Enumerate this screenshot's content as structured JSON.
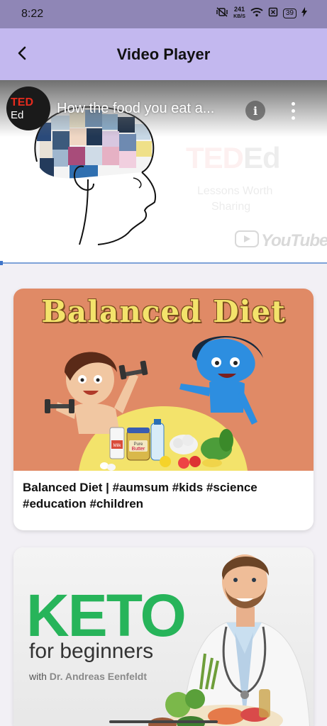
{
  "status_bar": {
    "time": "8:22",
    "net_speed_value": "241",
    "net_speed_unit": "KB/S",
    "battery": "39"
  },
  "app_bar": {
    "title": "Video Player",
    "back_icon": "back-arrow-icon"
  },
  "player": {
    "channel_avatar_top": "TED",
    "channel_avatar_bottom": "Ed",
    "video_title": "How the food you eat a...",
    "info_label": "i",
    "watermark_brand_a": "TED",
    "watermark_brand_b": "Ed",
    "watermark_line1": "Lessons Worth",
    "watermark_line2": "Sharing",
    "youtube_label": "YouTube"
  },
  "videos": [
    {
      "thumb_title": "Balanced Diet",
      "milk_label": "Milk",
      "butter_label_1": "Pure",
      "butter_label_2": "Butter",
      "caption": "Balanced Diet | #aumsum #kids #science #education #children"
    },
    {
      "thumb_word": "KETO",
      "thumb_sub": "for beginners",
      "thumb_with": "with",
      "thumb_author": "Dr. Andreas Eenfeldt"
    }
  ],
  "colors": {
    "status_bar": "#8f86b6",
    "app_bar": "#c3b8ef",
    "keto_green": "#27b45a",
    "balanced_bg": "#e08a66"
  }
}
